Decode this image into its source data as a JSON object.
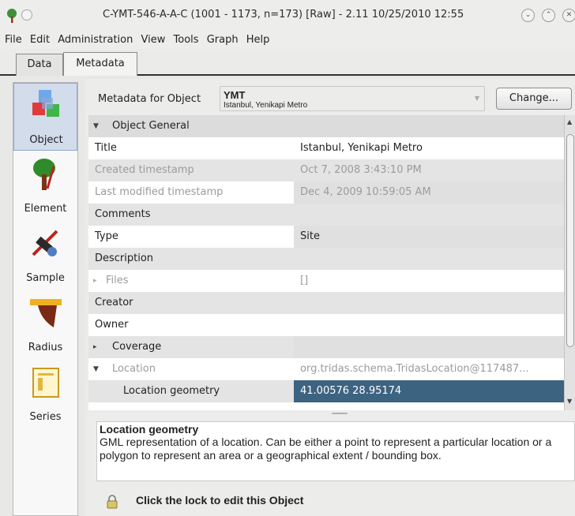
{
  "window": {
    "title": "C-YMT-546-A-A-C (1001 - 1173, n=173) [Raw] - 2.11 10/25/2010 12:55"
  },
  "menubar": [
    "File",
    "Edit",
    "Administration",
    "View",
    "Tools",
    "Graph",
    "Help"
  ],
  "tabs": [
    {
      "label": "Data",
      "active": false
    },
    {
      "label": "Metadata",
      "active": true
    }
  ],
  "sidebar": {
    "items": [
      {
        "label": "Object",
        "icon": "cubes-icon",
        "selected": true
      },
      {
        "label": "Element",
        "icon": "tree-icon",
        "selected": false
      },
      {
        "label": "Sample",
        "icon": "saw-icon",
        "selected": false
      },
      {
        "label": "Radius",
        "icon": "ruler-icon",
        "selected": false
      },
      {
        "label": "Series",
        "icon": "document-icon",
        "selected": false
      }
    ]
  },
  "metadata": {
    "label": "Metadata for Object",
    "object_code": "YMT",
    "object_name": "Istanbul, Yenikapi Metro",
    "change_button": "Change..."
  },
  "properties": [
    {
      "kind": "category",
      "label": "Object General",
      "expanded": true
    },
    {
      "label": "Title",
      "value": "Istanbul, Yenikapi Metro"
    },
    {
      "label": "Created timestamp",
      "value": "Oct 7, 2008 3:43:10 PM",
      "disabled": true
    },
    {
      "label": "Last modified timestamp",
      "value": "Dec 4, 2009 10:59:05 AM",
      "disabled": true
    },
    {
      "label": "Comments",
      "value": ""
    },
    {
      "label": "Type",
      "value": "Site"
    },
    {
      "label": "Description",
      "value": ""
    },
    {
      "label": "Files",
      "value": "[]",
      "disabled": true,
      "expandable": true
    },
    {
      "label": "Creator",
      "value": ""
    },
    {
      "label": "Owner",
      "value": ""
    },
    {
      "label": "Coverage",
      "value": "",
      "expandable": true
    },
    {
      "label": "Location",
      "value": "org.tridas.schema.TridasLocation@117487...",
      "disabled": true,
      "expandable": true,
      "expanded": true
    },
    {
      "label": "Location geometry",
      "value": "41.00576 28.95174",
      "selected": true,
      "indent": true
    }
  ],
  "description": {
    "title": "Location geometry",
    "text": "GML representation of a location. Can be either a point to represent a particular location or a polygon to represent an area or a geographical extent / bounding box."
  },
  "lock_message": "Click the lock to edit this Object",
  "colors": {
    "selection": "#3c6380",
    "sidebar_selected": "#d2dceb"
  }
}
